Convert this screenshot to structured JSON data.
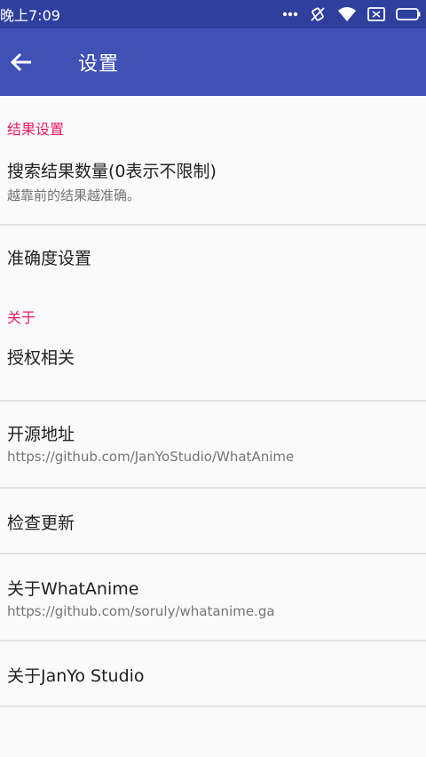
{
  "status_bar": {
    "time": "晚上7:09",
    "icons": [
      "more-dots-icon",
      "vibrate-off-icon",
      "wifi-icon",
      "sim-icon",
      "battery-icon"
    ]
  },
  "app_bar": {
    "title": "设置",
    "back_icon": "arrow-back-icon"
  },
  "sections": {
    "results": {
      "header": "结果设置",
      "result_count": {
        "title": "搜索结果数量(0表示不限制)",
        "summary": "越靠前的结果越准确。"
      },
      "accuracy": {
        "title": "准确度设置"
      }
    },
    "about": {
      "header": "关于",
      "license": {
        "title": "授权相关"
      },
      "source": {
        "title": "开源地址",
        "summary": "https://github.com/JanYoStudio/WhatAnime"
      },
      "update": {
        "title": "检查更新"
      },
      "whatanime": {
        "title": "关于WhatAnime",
        "summary": "https://github.com/soruly/whatanime.ga"
      },
      "janyo": {
        "title": "关于JanYo Studio"
      }
    }
  },
  "colors": {
    "app_bar": "#3f51b5",
    "status_bar": "#2f3f9e",
    "accent": "#e91e63"
  }
}
